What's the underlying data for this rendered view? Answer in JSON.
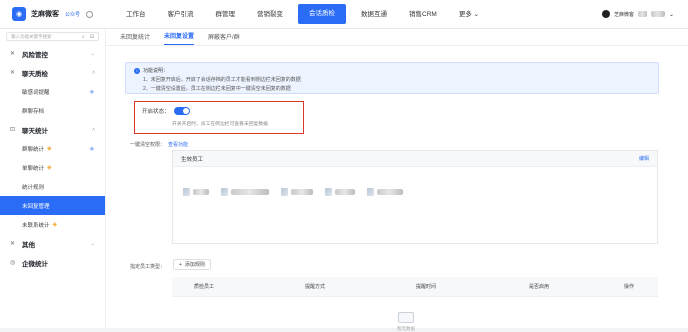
{
  "brand": {
    "name": "芝麻微客",
    "account": "公众号"
  },
  "search": {
    "placeholder": "输入功能关键字搜索"
  },
  "nav": {
    "items": [
      "工作台",
      "客户引流",
      "群管理",
      "营销裂变",
      "会话质检",
      "数据互通",
      "销售CRM",
      "更多"
    ],
    "active": 4
  },
  "user": {
    "name": "芝麻微客"
  },
  "sidebar": {
    "risk": "风险管控",
    "chatqc": "聊天质检",
    "sensitive": "敏感词提醒",
    "groupmsg": "群聊存档",
    "chatstats": "聊天统计",
    "group_stats": "群聊统计",
    "single_stats": "单聊统计",
    "stats_rule": "统计规则",
    "unreplied": "未回复管理",
    "unlinked": "未联系统计",
    "other": "其他",
    "enterprise": "企微统计"
  },
  "tabs": [
    "未回复统计",
    "未回复设置",
    "屏蔽客户/群"
  ],
  "notice": {
    "title": "功能说明：",
    "line1": "1、未回复开启后，开启了会话存档的员工才能看到侧边栏未回复的数据",
    "line2": "2、一键清空设置后，员工在侧边栏未回复中一键清空未回复的数据"
  },
  "switch": {
    "label": "开启状态：",
    "hint": "开关开启时，员工在侧边栏可查看未回复数据"
  },
  "perm": {
    "label": "一键清空权限：",
    "link": "查看功能"
  },
  "employees": {
    "title": "生效员工",
    "edit": "编辑"
  },
  "rules": {
    "label": "指定员工类型：",
    "add": "添加规则"
  },
  "table": {
    "cols": [
      "质检员工",
      "提醒方式",
      "提醒时间",
      "是否启用",
      "操作"
    ]
  },
  "empty": {
    "text": "暂无数据"
  }
}
